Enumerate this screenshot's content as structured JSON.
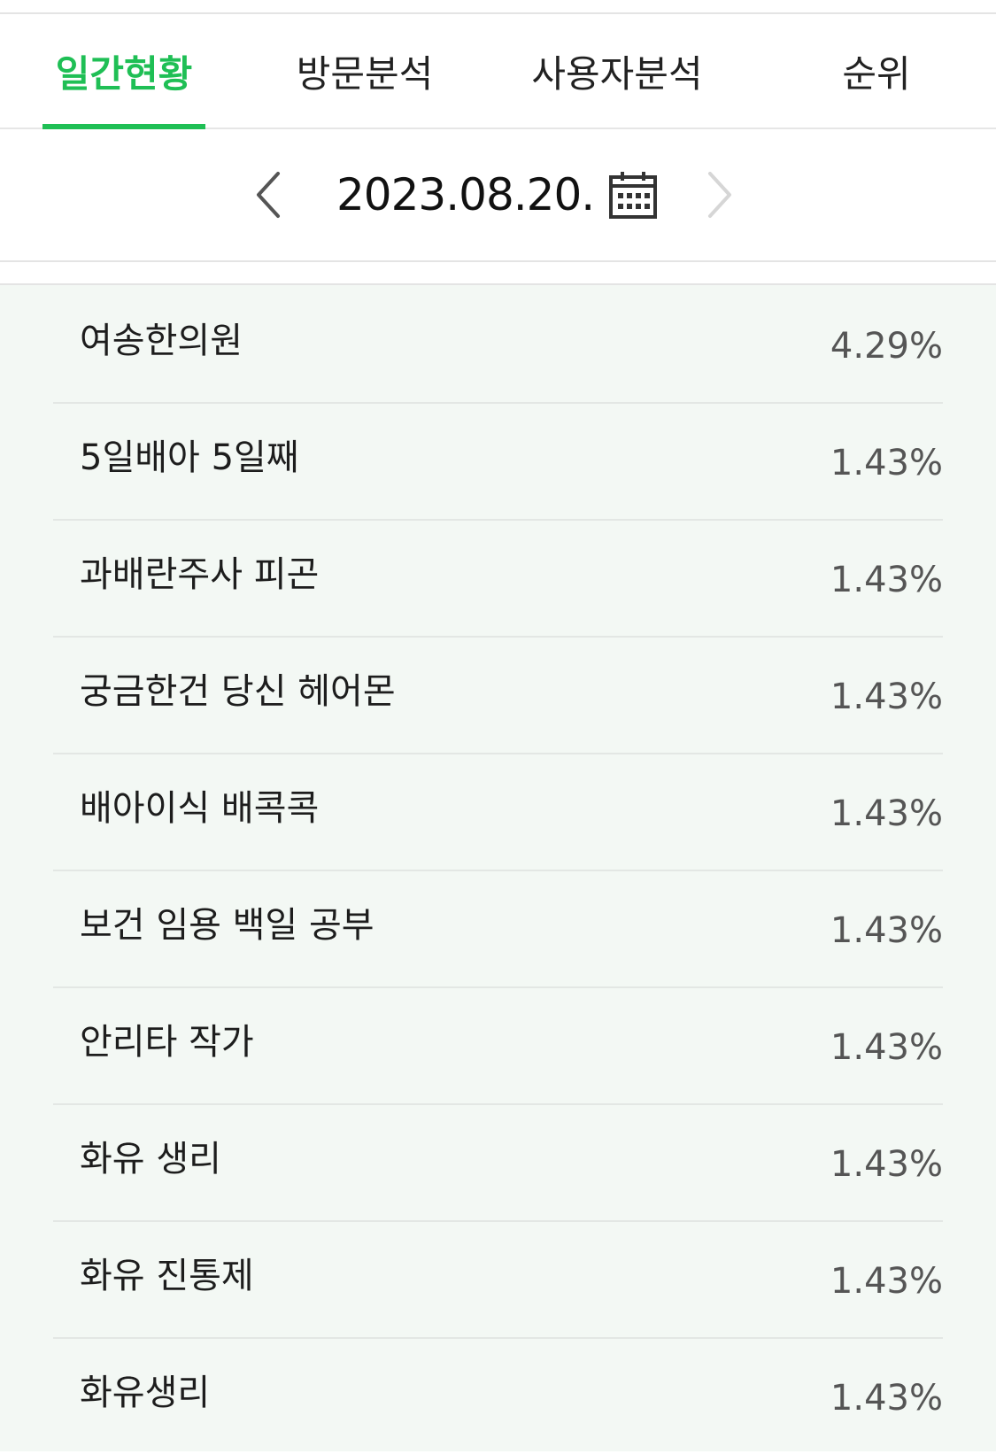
{
  "tabs": [
    {
      "label": "일간현황",
      "active": true
    },
    {
      "label": "방문분석",
      "active": false
    },
    {
      "label": "사용자분석",
      "active": false
    },
    {
      "label": "순위",
      "active": false
    }
  ],
  "date_nav": {
    "date": "2023.08.20.",
    "prev_icon": "chevron-left-icon",
    "next_icon": "chevron-right-icon",
    "calendar_icon": "calendar-icon"
  },
  "keywords": [
    {
      "label": "여송한의원",
      "value": "4.29%"
    },
    {
      "label": "5일배아 5일째",
      "value": "1.43%"
    },
    {
      "label": "과배란주사 피곤",
      "value": "1.43%"
    },
    {
      "label": "궁금한건 당신 헤어몬",
      "value": "1.43%"
    },
    {
      "label": "배아이식 배콕콕",
      "value": "1.43%"
    },
    {
      "label": "보건 임용 백일 공부",
      "value": "1.43%"
    },
    {
      "label": "안리타 작가",
      "value": "1.43%"
    },
    {
      "label": "화유 생리",
      "value": "1.43%"
    },
    {
      "label": "화유 진통제",
      "value": "1.43%"
    },
    {
      "label": "화유생리",
      "value": "1.43%"
    }
  ],
  "colors": {
    "accent": "#1fbf55",
    "list_bg": "#f3f8f4"
  }
}
